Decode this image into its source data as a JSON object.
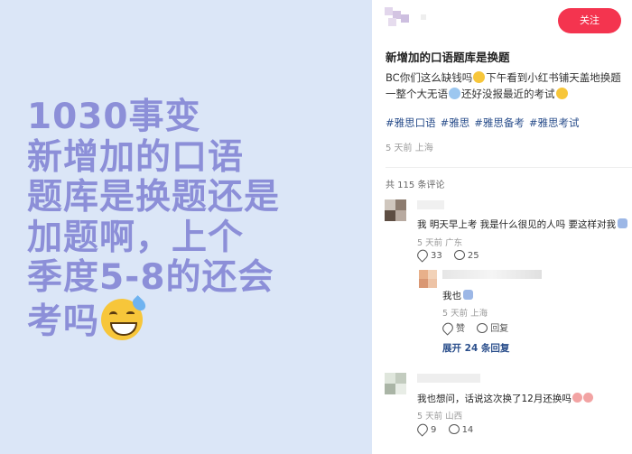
{
  "image_text": {
    "lines": [
      "1030事变",
      "新增加的口语",
      "题库是换题还是",
      "加题啊，上个",
      "季度5-8的还会",
      "考吗"
    ],
    "emoji": "sweat-smile-emoji"
  },
  "header": {
    "follow_label": "关注"
  },
  "post": {
    "title": "新增加的口语题库是换题",
    "body_1": "BC你们这么缺钱吗",
    "body_2": "下午看到小红书铺天盖地换题",
    "body_3": "一整个大无语",
    "body_4": "还好没报最近的考试",
    "tags": [
      "#雅思口语",
      "#雅思",
      "#雅思备考",
      "#雅思考试"
    ],
    "meta": "5 天前 上海"
  },
  "comments_header": "共 115 条评论",
  "comments": [
    {
      "text": "我 明天早上考 我是什么很见的人吗 要这样对我",
      "meta": "5 天前 广东",
      "likes": "33",
      "replies": "25"
    },
    {
      "text": "我也",
      "meta": "5 天前 上海",
      "like_label": "赞",
      "reply_label": "回复"
    },
    {
      "text": "我也想问，话说这次换了12月还换吗",
      "meta": "5 天前 山西",
      "likes": "9",
      "replies": "14"
    }
  ],
  "expand_label": "展开 24 条回复",
  "colors": {
    "accent": "#f4344f",
    "tag": "#2b4f8c",
    "image_bg": "#dbe6f7",
    "image_text": "#8c8fd8"
  }
}
